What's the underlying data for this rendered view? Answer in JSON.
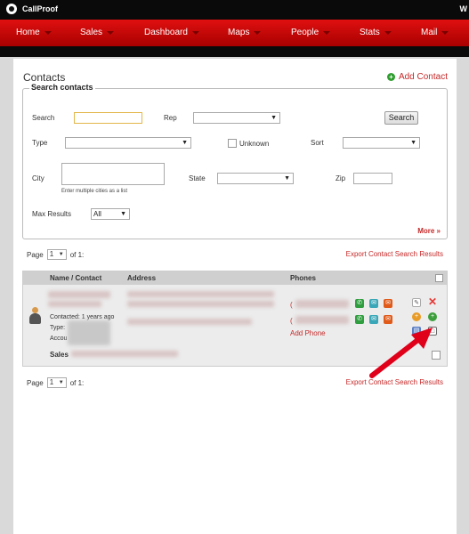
{
  "app": {
    "name": "CallProof",
    "top_right": "W"
  },
  "nav": [
    {
      "label": "Home"
    },
    {
      "label": "Sales"
    },
    {
      "label": "Dashboard"
    },
    {
      "label": "Maps"
    },
    {
      "label": "People"
    },
    {
      "label": "Stats"
    },
    {
      "label": "Mail"
    }
  ],
  "page": {
    "title": "Contacts",
    "add_contact": "Add Contact"
  },
  "search": {
    "legend": "Search contacts",
    "search_label": "Search",
    "search_value": "",
    "rep_label": "Rep",
    "rep_value": "",
    "search_button": "Search",
    "type_label": "Type",
    "type_value": "",
    "unknown_label": "Unknown",
    "sort_label": "Sort",
    "sort_value": "",
    "city_label": "City",
    "city_value": "",
    "city_note": "Enter multiple cities as a list",
    "state_label": "State",
    "state_value": "",
    "zip_label": "Zip",
    "zip_value": "",
    "max_label": "Max Results",
    "max_value": "All",
    "more_link": "More »"
  },
  "pager": {
    "page_label": "Page",
    "page_value": "1",
    "of_label": "of 1:"
  },
  "export_link": "Export Contact Search Results",
  "table": {
    "columns": [
      "Name / Contact",
      "Address",
      "Phones"
    ],
    "row": {
      "contacted": "Contacted: 1 years ago",
      "type_label": "Type:",
      "account_label": "Accou",
      "sales_label": "Sales",
      "phone_prefix_1": "(",
      "phone_prefix_2": "(",
      "add_phone": "Add Phone"
    }
  },
  "icons": {
    "call": "phone-icon",
    "sms": "sms-icon",
    "email": "email-icon",
    "edit": "edit-icon",
    "delete": "delete-icon",
    "add_orange": "add-task-icon",
    "add_green": "add-icon",
    "book": "address-book-icon",
    "note": "note-icon"
  },
  "colors": {
    "nav_red": "#d40000",
    "link_red": "#c62828",
    "green": "#2e9e2e",
    "annotation_arrow": "#e0001a"
  }
}
